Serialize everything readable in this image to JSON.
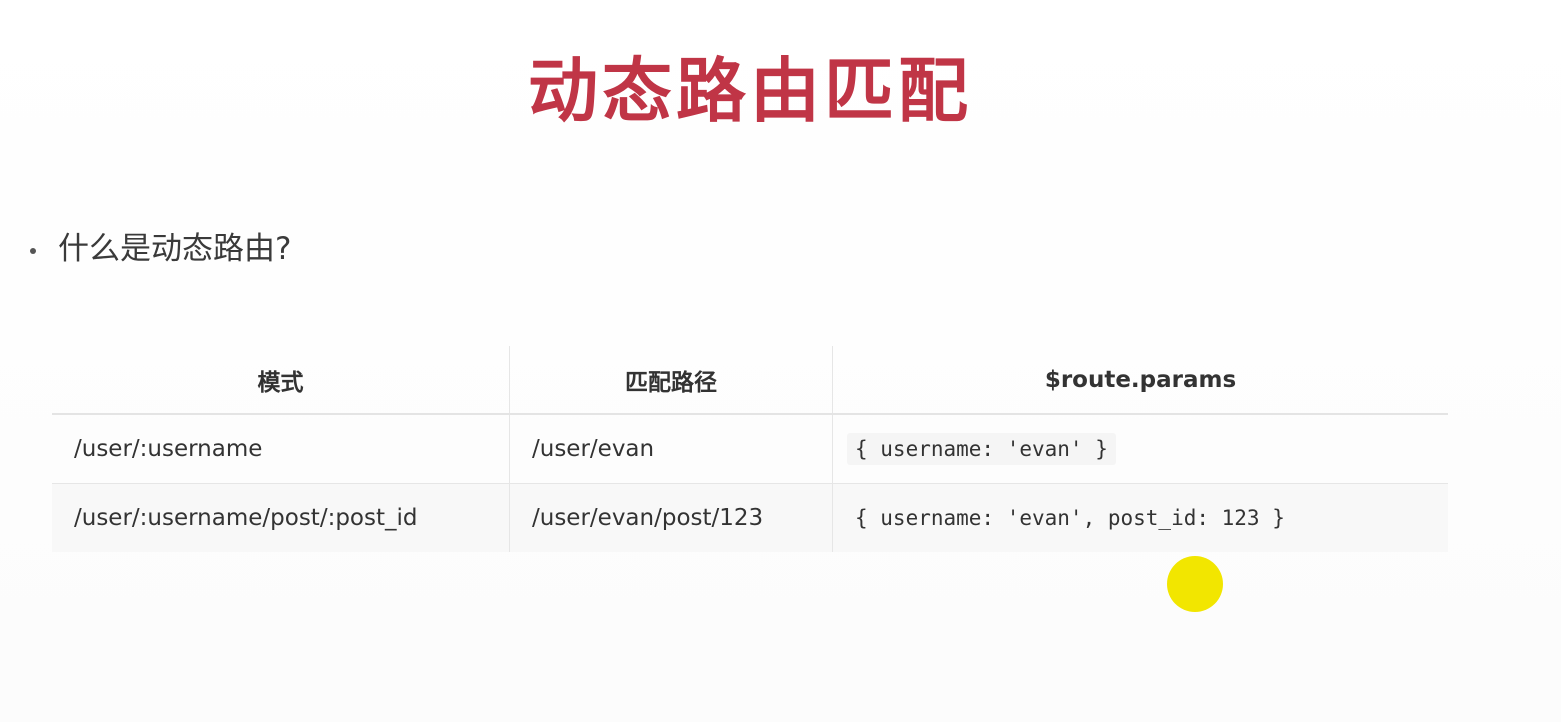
{
  "slide": {
    "title": "动态路由匹配",
    "bullet": "什么是动态路由?"
  },
  "table": {
    "headers": [
      "模式",
      "匹配路径",
      "$route.params"
    ],
    "rows": [
      [
        "/user/:username",
        "/user/evan",
        "{ username: 'evan' }"
      ],
      [
        "/user/:username/post/:post_id",
        "/user/evan/post/123",
        "{ username: 'evan', post_id: 123 }"
      ]
    ]
  },
  "colors": {
    "title": "#c03546",
    "cursor_highlight": "#f2e600"
  }
}
